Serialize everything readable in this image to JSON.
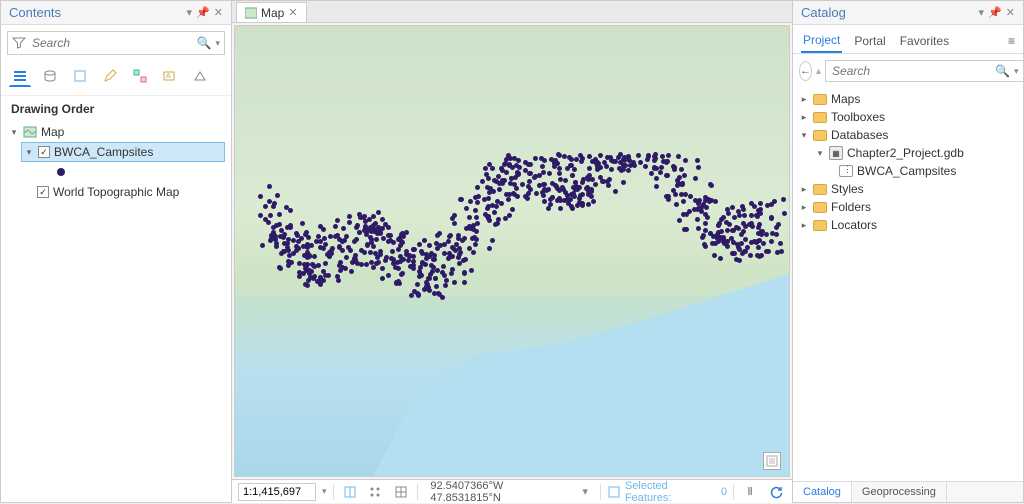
{
  "contents": {
    "title": "Contents",
    "search_placeholder": "Search",
    "section_title": "Drawing Order",
    "map_label": "Map",
    "layers": [
      {
        "name": "BWCA_Campsites",
        "checked": true,
        "selected": true,
        "symbol": "point"
      },
      {
        "name": "World Topographic Map",
        "checked": true,
        "selected": false,
        "symbol": null
      }
    ]
  },
  "map_tab": {
    "label": "Map"
  },
  "statusbar": {
    "scale": "1:1,415,697",
    "coords": "92.5407366°W 47.8531815°N",
    "selected_features_label": "Selected Features:",
    "selected_features_count": "0"
  },
  "catalog": {
    "title": "Catalog",
    "tabs": [
      "Project",
      "Portal",
      "Favorites"
    ],
    "active_tab": 0,
    "search_placeholder": "Search",
    "tree": {
      "maps": "Maps",
      "toolboxes": "Toolboxes",
      "databases": "Databases",
      "gdb": "Chapter2_Project.gdb",
      "fc": "BWCA_Campsites",
      "styles": "Styles",
      "folders": "Folders",
      "locators": "Locators"
    },
    "bottom_tabs": [
      "Catalog",
      "Geoprocessing"
    ],
    "bottom_active": 0
  },
  "colors": {
    "accent": "#2a7de1",
    "point": "#2e1a66"
  }
}
